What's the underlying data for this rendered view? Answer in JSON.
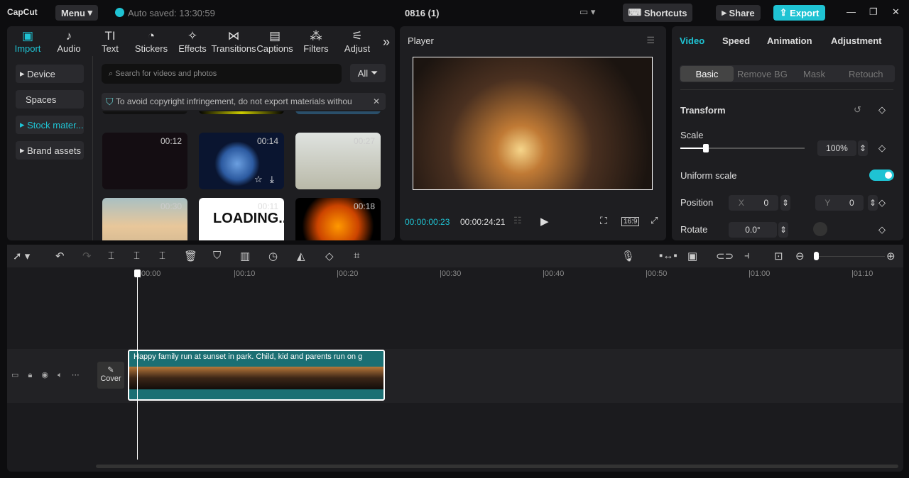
{
  "topbar": {
    "logo": "CapCut",
    "menu": "Menu",
    "autosave": "Auto saved: 13:30:59",
    "project_title": "0816 (1)",
    "shortcuts": "Shortcuts",
    "share": "Share",
    "export": "Export"
  },
  "toolbar": [
    {
      "label": "Import",
      "icon": "import-icon"
    },
    {
      "label": "Audio",
      "icon": "audio-icon"
    },
    {
      "label": "Text",
      "icon": "text-icon"
    },
    {
      "label": "Stickers",
      "icon": "stickers-icon"
    },
    {
      "label": "Effects",
      "icon": "effects-icon"
    },
    {
      "label": "Transitions",
      "icon": "transitions-icon"
    },
    {
      "label": "Captions",
      "icon": "captions-icon"
    },
    {
      "label": "Filters",
      "icon": "filters-icon"
    },
    {
      "label": "Adjust",
      "icon": "adjust-icon"
    }
  ],
  "sidebar": [
    "Device",
    "Spaces",
    "Stock mater...",
    "Brand assets"
  ],
  "media": {
    "search_placeholder": "Search for videos and photos",
    "filter": "All",
    "notice": "To avoid copyright infringement, do not export materials withou",
    "thumbs": [
      {
        "duration": "00:12"
      },
      {
        "duration": "00:14"
      },
      {
        "duration": "00:27"
      },
      {
        "duration": "00:30"
      },
      {
        "duration": "00:11",
        "text": "LOADING..."
      },
      {
        "duration": "00:18"
      }
    ]
  },
  "player": {
    "title": "Player",
    "current": "00:00:00:23",
    "total": "00:00:24:21",
    "ratio": "16:9"
  },
  "right": {
    "tabs": [
      "Video",
      "Speed",
      "Animation",
      "Adjustment"
    ],
    "subtabs": [
      "Basic",
      "Remove BG",
      "Mask",
      "Retouch"
    ],
    "section": "Transform",
    "scale_label": "Scale",
    "scale": "100%",
    "scale_value": 100,
    "uniform": "Uniform scale",
    "uniform_on": true,
    "position_label": "Position",
    "x_label": "X",
    "x": "0",
    "y_label": "Y",
    "y": "0",
    "rotate_label": "Rotate",
    "rotate": "0.0°"
  },
  "timeline": {
    "ticks": [
      "00:00",
      "00:10",
      "00:20",
      "00:30",
      "00:40",
      "00:50",
      "01:00",
      "01:10"
    ],
    "clip_title": "Happy family run at sunset in park. Child, kid and parents run on g",
    "cover": "Cover"
  },
  "colors": {
    "accent": "#1fc3d3"
  }
}
